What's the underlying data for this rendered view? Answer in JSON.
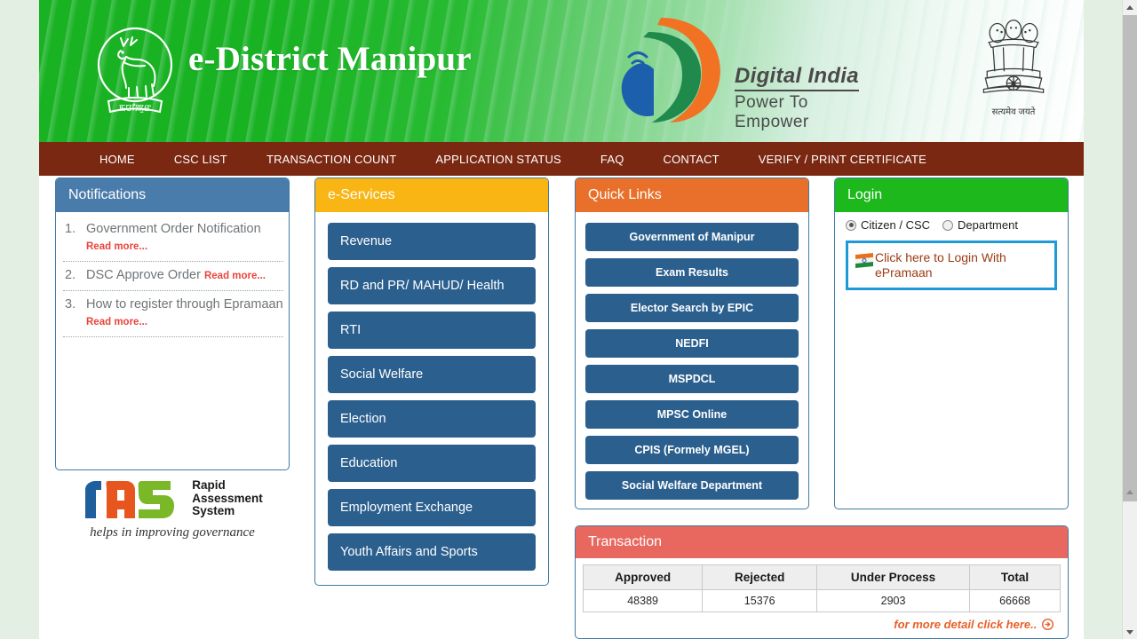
{
  "header": {
    "site_title": "e-District Manipur",
    "state_emblem_name": "manipur-state-emblem",
    "state_emblem_caption": "ꯃꯅꯤꯄꯨꯔ",
    "digital_india": {
      "line1": "Digital India",
      "line2": "Power To Empower"
    },
    "ashoka": {
      "motto": "सत्यमेव जयते"
    }
  },
  "nav": {
    "items": [
      {
        "label": "HOME"
      },
      {
        "label": "CSC LIST"
      },
      {
        "label": "TRANSACTION COUNT"
      },
      {
        "label": "APPLICATION STATUS"
      },
      {
        "label": "FAQ"
      },
      {
        "label": "CONTACT"
      },
      {
        "label": "VERIFY / PRINT CERTIFICATE"
      }
    ]
  },
  "notifications": {
    "title": "Notifications",
    "read_more_label": "Read more...",
    "items": [
      {
        "text": "Government Order Notification",
        "wrap": true
      },
      {
        "text": "DSC Approve Order",
        "wrap": false
      },
      {
        "text": "How to register through Epramaan",
        "wrap": false
      }
    ]
  },
  "ras": {
    "logo_text": "ras",
    "name_line1": "Rapid",
    "name_line2": "Assessment",
    "name_line3": "System",
    "tagline": "helps in improving governance"
  },
  "eservices": {
    "title": "e-Services",
    "items": [
      {
        "label": "Revenue"
      },
      {
        "label": "RD and PR/ MAHUD/ Health"
      },
      {
        "label": "RTI"
      },
      {
        "label": "Social Welfare"
      },
      {
        "label": "Election"
      },
      {
        "label": "Education"
      },
      {
        "label": "Employment Exchange"
      },
      {
        "label": "Youth Affairs and Sports"
      }
    ]
  },
  "quicklinks": {
    "title": "Quick Links",
    "items": [
      {
        "label": "Government of Manipur"
      },
      {
        "label": "Exam Results"
      },
      {
        "label": "Elector Search by EPIC"
      },
      {
        "label": "NEDFI"
      },
      {
        "label": "MSPDCL"
      },
      {
        "label": "MPSC Online"
      },
      {
        "label": "CPIS (Formely MGEL)"
      },
      {
        "label": "Social Welfare Department"
      }
    ]
  },
  "login": {
    "title": "Login",
    "radios": [
      {
        "label": "Citizen / CSC",
        "selected": true
      },
      {
        "label": "Department",
        "selected": false
      }
    ],
    "epramaan_label": "Click here to Login With ePramaan"
  },
  "transaction": {
    "title": "Transaction",
    "columns": [
      "Approved",
      "Rejected",
      "Under Process",
      "Total"
    ],
    "row": [
      "48389",
      "15376",
      "2903",
      "66668"
    ],
    "more_label": "for more detail click here.."
  },
  "colors": {
    "banner_green": "#18b222",
    "nav_maroon": "#7a2812",
    "notifications_header": "#4a7cab",
    "eservices_header": "#f9b514",
    "quicklinks_header": "#e8702a",
    "login_header": "#1cb81c",
    "transaction_header": "#e8685f",
    "button_blue": "#2b5f8e",
    "read_more_red": "#e8453c",
    "epramaan_border": "#1e9ad6",
    "epramaan_text": "#9a3b14",
    "page_background": "#e4efe4"
  }
}
